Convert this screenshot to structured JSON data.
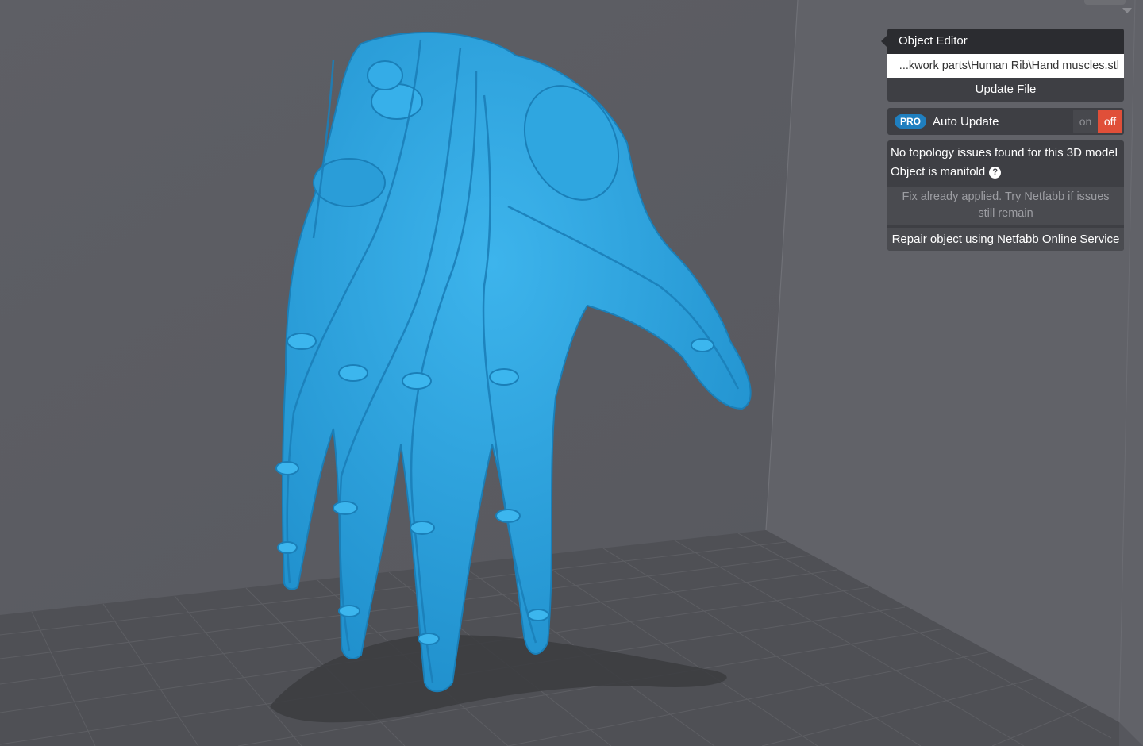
{
  "object_editor": {
    "title": "Object Editor",
    "file_path": "...kwork parts\\Human Rib\\Hand muscles.stl",
    "update_button": "Update File"
  },
  "auto_update": {
    "badge": "PRO",
    "label": "Auto Update",
    "on_label": "on",
    "off_label": "off",
    "state": "off"
  },
  "analysis": {
    "topology_message": "No topology issues found for this 3D model",
    "manifold_message": "Object is manifold",
    "help_icon": "?",
    "fix_note": "Fix already applied. Try Netfabb if issues still remain",
    "repair_button": "Repair object using Netfabb Online Service"
  },
  "colors": {
    "background": "#5b5c62",
    "model": "#2fa6e0",
    "toggle_off": "#e04f39",
    "pro_badge": "#1f7fbf"
  }
}
